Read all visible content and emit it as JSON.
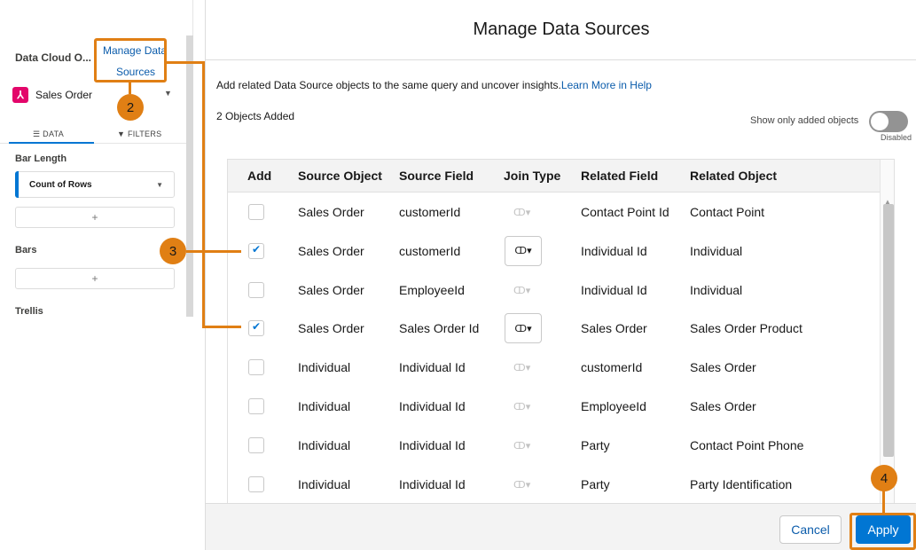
{
  "sidebar": {
    "title": "Data Cloud O...",
    "manage_link_line1": "Manage Data",
    "manage_link_line2": "Sources",
    "object_name": "Sales Order",
    "tabs": {
      "data": "☰ DATA",
      "filters": "▼ FILTERS"
    },
    "sections": {
      "bar_length": "Bar Length",
      "bars": "Bars",
      "trellis": "Trellis"
    },
    "field_label": "Count of Rows",
    "add_symbol": "+"
  },
  "modal": {
    "title": "Manage Data Sources",
    "info_text": "Add related Data Source objects to the same query and uncover insights.",
    "learn_more": "Learn More in Help",
    "objects_added": "2 Objects Added",
    "toggle_label": "Show only added objects",
    "toggle_state": "Disabled",
    "columns": [
      "Add",
      "Source Object",
      "Source Field",
      "Join Type",
      "Related Field",
      "Related Object"
    ],
    "rows": [
      {
        "checked": false,
        "source_object": "Sales Order",
        "source_field": "customerId",
        "join_enabled": false,
        "related_field": "Contact Point Id",
        "related_object": "Contact Point"
      },
      {
        "checked": true,
        "source_object": "Sales Order",
        "source_field": "customerId",
        "join_enabled": true,
        "related_field": "Individual Id",
        "related_object": "Individual"
      },
      {
        "checked": false,
        "source_object": "Sales Order",
        "source_field": "EmployeeId",
        "join_enabled": false,
        "related_field": "Individual Id",
        "related_object": "Individual"
      },
      {
        "checked": true,
        "source_object": "Sales Order",
        "source_field": "Sales Order Id",
        "join_enabled": true,
        "related_field": "Sales Order",
        "related_object": "Sales Order Product"
      },
      {
        "checked": false,
        "source_object": "Individual",
        "source_field": "Individual Id",
        "join_enabled": false,
        "related_field": "customerId",
        "related_object": "Sales Order"
      },
      {
        "checked": false,
        "source_object": "Individual",
        "source_field": "Individual Id",
        "join_enabled": false,
        "related_field": "EmployeeId",
        "related_object": "Sales Order"
      },
      {
        "checked": false,
        "source_object": "Individual",
        "source_field": "Individual Id",
        "join_enabled": false,
        "related_field": "Party",
        "related_object": "Contact Point Phone"
      },
      {
        "checked": false,
        "source_object": "Individual",
        "source_field": "Individual Id",
        "join_enabled": false,
        "related_field": "Party",
        "related_object": "Party Identification"
      }
    ],
    "join_glyph": "ↀ▾",
    "cancel_label": "Cancel",
    "apply_label": "Apply"
  },
  "callouts": {
    "step2": "2",
    "step3": "3",
    "step4": "4"
  },
  "colors": {
    "accent": "#0176d3",
    "callout": "#e07f14"
  }
}
